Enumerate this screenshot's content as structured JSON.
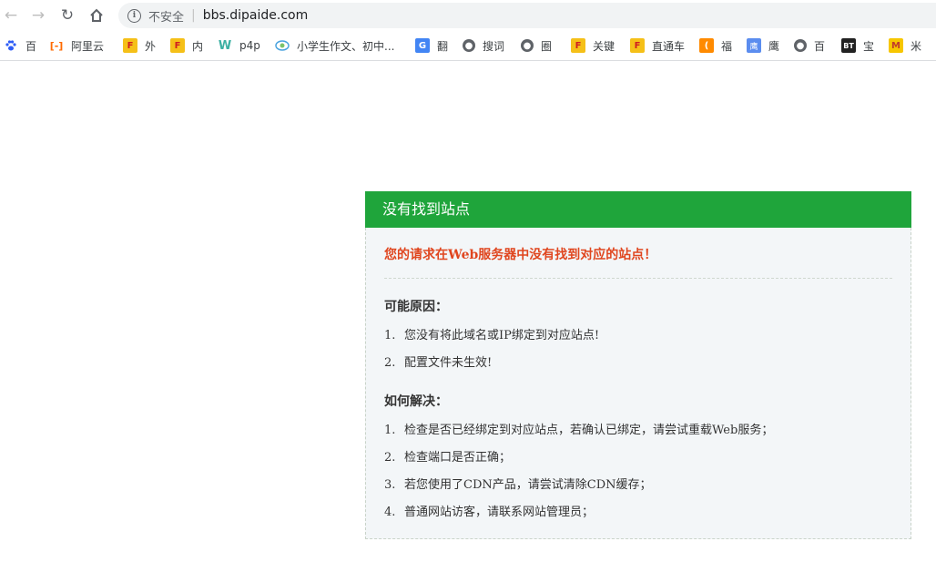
{
  "browser": {
    "security_label": "不安全",
    "separator": "|",
    "url": "bbs.dipaide.com"
  },
  "bookmarks": [
    {
      "label": "百",
      "icon": "baidu-paw-icon",
      "color": "#2d5cf6"
    },
    {
      "label": "阿里云",
      "icon": "aliyun-icon",
      "color": "#ff6a00"
    },
    {
      "label": "外",
      "icon": "flag-icon",
      "color": "#f5a623"
    },
    {
      "label": "内",
      "icon": "flag-icon",
      "color": "#f5a623"
    },
    {
      "label": "p4p",
      "icon": "leaf-icon",
      "color": "#3bb0a3"
    },
    {
      "label": "小学生作文、初中...",
      "icon": "logo-icon",
      "color": "#4aa3df"
    },
    {
      "label": "翻",
      "icon": "translate-icon",
      "color": "#4285f4"
    },
    {
      "label": "搜词",
      "icon": "globe-icon",
      "color": "#5f6368"
    },
    {
      "label": "圈",
      "icon": "globe-icon",
      "color": "#5f6368"
    },
    {
      "label": "关键",
      "icon": "flag-icon",
      "color": "#f5a623"
    },
    {
      "label": "直通车",
      "icon": "flag-icon",
      "color": "#f5a623"
    },
    {
      "label": "福",
      "icon": "moon-icon",
      "color": "#ff8a00"
    },
    {
      "label": "鹰",
      "icon": "eagle-icon",
      "color": "#5b8def"
    },
    {
      "label": "百",
      "icon": "globe-icon",
      "color": "#5f6368"
    },
    {
      "label": "宝",
      "icon": "bt-icon",
      "color": "#222222"
    },
    {
      "label": "米",
      "icon": "mail-icon",
      "color": "#f7c600"
    }
  ],
  "card": {
    "header": "没有找到站点",
    "error": "您的请求在Web服务器中没有找到对应的站点！",
    "reasons_title": "可能原因：",
    "reasons": [
      {
        "num": "1.",
        "text": "您没有将此域名或IP绑定到对应站点!"
      },
      {
        "num": "2.",
        "text": "配置文件未生效!"
      }
    ],
    "solutions_title": "如何解决：",
    "solutions": [
      {
        "num": "1.",
        "text": "检查是否已经绑定到对应站点，若确认已绑定，请尝试重载Web服务；"
      },
      {
        "num": "2.",
        "text": "检查端口是否正确；"
      },
      {
        "num": "3.",
        "text": "若您使用了CDN产品，请尝试清除CDN缓存；"
      },
      {
        "num": "4.",
        "text": "普通网站访客，请联系网站管理员；"
      }
    ]
  }
}
